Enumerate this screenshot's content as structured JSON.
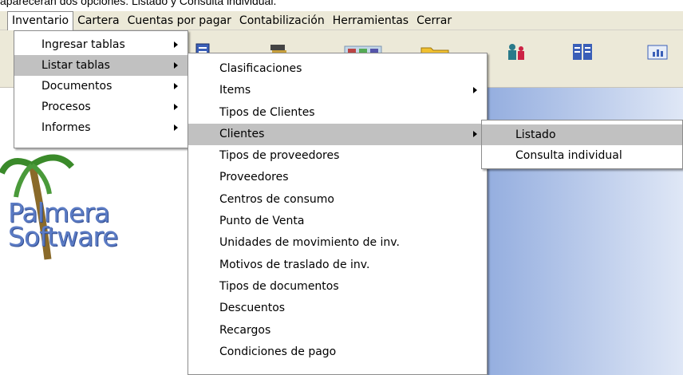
{
  "caption": "aparecerán dos opciones: Listado y Consulta individual.",
  "menubar": {
    "items": [
      "Inventario",
      "Cartera",
      "Cuentas por pagar",
      "Contabilización",
      "Herramientas",
      "Cerrar"
    ]
  },
  "menu_inventario": {
    "items": [
      "Ingresar tablas",
      "Listar tablas",
      "Documentos",
      "Procesos",
      "Informes"
    ]
  },
  "menu_listar_tablas": {
    "items": [
      "Clasificaciones",
      "Items",
      "Tipos de Clientes",
      "Clientes",
      "Tipos de proveedores",
      "Proveedores",
      "Centros de consumo",
      "Punto de Venta",
      "Unidades de movimiento de inv.",
      "Motivos de traslado de inv.",
      "Tipos de documentos",
      "Descuentos",
      "Recargos",
      "Condiciones de pago"
    ]
  },
  "menu_clientes": {
    "items": [
      "Listado",
      "Consulta individual"
    ]
  },
  "logo": {
    "line1": "Palmera",
    "line2": "Software"
  },
  "toolbar": {
    "icons": [
      "catalog-icon",
      "stack-icon",
      "palette-icon",
      "folder-icon",
      "users-icon",
      "list-icon",
      "report-icon"
    ]
  },
  "colors": {
    "menu_highlight": "#c1c1c1",
    "menubar_bg": "#ece9d8",
    "logo_blue": "#5b7bc4",
    "panel_blue": "#2c4fa8"
  }
}
